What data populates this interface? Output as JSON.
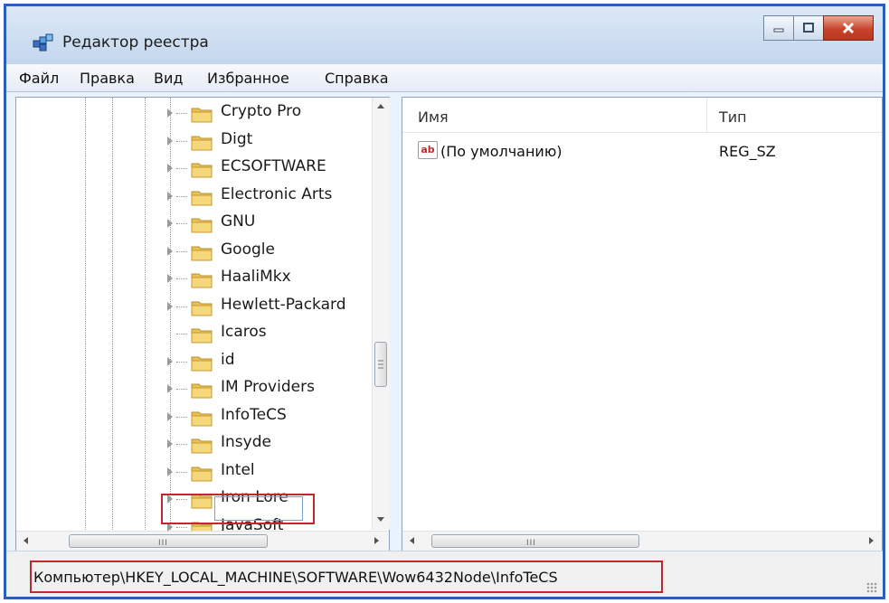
{
  "window": {
    "title": "Редактор реестра",
    "buttons": {
      "minimize": "minimize",
      "maximize": "maximize",
      "close": "close"
    }
  },
  "menu": [
    "Файл",
    "Правка",
    "Вид",
    "Избранное",
    "Справка"
  ],
  "tree": {
    "items": [
      {
        "label": "Crypto Pro",
        "expandable": true
      },
      {
        "label": "Digt",
        "expandable": true
      },
      {
        "label": "ECSOFTWARE",
        "expandable": true
      },
      {
        "label": "Electronic Arts",
        "expandable": true
      },
      {
        "label": "GNU",
        "expandable": true
      },
      {
        "label": "Google",
        "expandable": true
      },
      {
        "label": "HaaliMkx",
        "expandable": true
      },
      {
        "label": "Hewlett-Packard",
        "expandable": true
      },
      {
        "label": "Icaros",
        "expandable": false
      },
      {
        "label": "id",
        "expandable": true
      },
      {
        "label": "IM Providers",
        "expandable": true
      },
      {
        "label": "InfoTeCS",
        "expandable": true,
        "selected": true
      },
      {
        "label": "Insyde",
        "expandable": true
      },
      {
        "label": "Intel",
        "expandable": true
      },
      {
        "label": "Iron Lore",
        "expandable": true
      },
      {
        "label": "JavaSoft",
        "expandable": true
      }
    ],
    "hscroll_grip": "III"
  },
  "list": {
    "columns": {
      "name": "Имя",
      "type": "Тип"
    },
    "rows": [
      {
        "icon": "ab",
        "name": "(По умолчанию)",
        "type": "REG_SZ"
      }
    ],
    "hscroll_grip": "III"
  },
  "status": {
    "path": "Компьютер\\HKEY_LOCAL_MACHINE\\SOFTWARE\\Wow6432Node\\InfoTeCS"
  },
  "colors": {
    "highlight": "#c0282a",
    "frame": "#2a5fbe"
  },
  "icons": [
    "registry-editor-icon",
    "folder-icon",
    "string-value-icon",
    "minimize-icon",
    "maximize-icon",
    "close-icon"
  ]
}
